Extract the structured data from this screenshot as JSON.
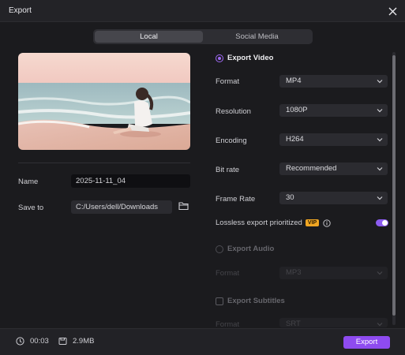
{
  "window": {
    "title": "Export"
  },
  "tabs": [
    {
      "label": "Local",
      "active": true
    },
    {
      "label": "Social Media",
      "active": false
    }
  ],
  "left": {
    "name_label": "Name",
    "name_value": "2025-11-11_04",
    "save_label": "Save to",
    "save_value": "C:/Users/dell/Downloads"
  },
  "export_video": {
    "header": "Export Video",
    "selected": true,
    "rows": [
      {
        "label": "Format",
        "value": "MP4"
      },
      {
        "label": "Resolution",
        "value": "1080P"
      },
      {
        "label": "Encoding",
        "value": "H264"
      },
      {
        "label": "Bit rate",
        "value": "Recommended"
      },
      {
        "label": "Frame Rate",
        "value": "30"
      }
    ],
    "lossless_label": "Lossless export prioritized",
    "vip_badge": "VIP",
    "lossless_on": true
  },
  "export_audio": {
    "header": "Export Audio",
    "row": {
      "label": "Format",
      "value": "MP3"
    }
  },
  "export_subtitles": {
    "header": "Export Subtitles",
    "row": {
      "label": "Format",
      "value": "SRT"
    }
  },
  "footer": {
    "duration": "00:03",
    "size": "2.9MB",
    "export_label": "Export"
  },
  "colors": {
    "accent": "#8e4bf0",
    "vip": "#f0a623",
    "background": "#1b1b1e"
  },
  "icons": [
    "close-icon",
    "folder-icon",
    "info-icon",
    "clock-icon",
    "file-size-icon",
    "chevron-down-icon"
  ]
}
